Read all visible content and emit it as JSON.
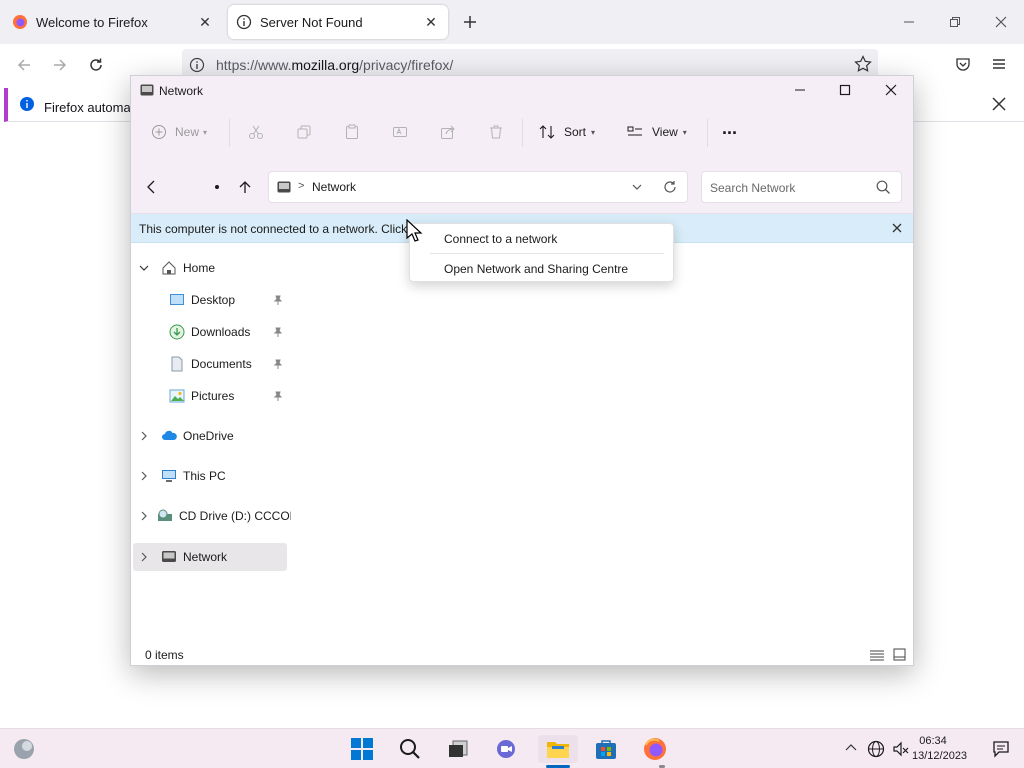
{
  "browser": {
    "tabs": [
      {
        "title": "Welcome to Firefox",
        "active": false
      },
      {
        "title": "Server Not Found",
        "active": true
      }
    ],
    "url_prefix": "https://www.",
    "url_domain": "mozilla.org",
    "url_path": "/privacy/firefox/",
    "notification": "Firefox automati"
  },
  "explorer": {
    "title": "Network",
    "toolbar": {
      "new_label": "New",
      "sort_label": "Sort",
      "view_label": "View",
      "more_label": "..."
    },
    "address": {
      "separator": ">",
      "location": "Network"
    },
    "search": {
      "placeholder": "Search Network"
    },
    "infobar": {
      "text": "This computer is not connected to a network. Click t"
    },
    "nav": {
      "home": "Home",
      "quick": [
        "Desktop",
        "Downloads",
        "Documents",
        "Pictures"
      ],
      "roots": [
        "OneDrive",
        "This PC",
        "CD Drive (D:) CCCOM",
        "Network"
      ]
    },
    "status": {
      "items": "0 items"
    }
  },
  "context_menu": {
    "items": [
      "Connect to a network",
      "Open Network and Sharing Centre"
    ]
  },
  "taskbar": {
    "time": "06:34",
    "date": "13/12/2023"
  },
  "colors": {
    "accent": "#0067c0",
    "explorer_bg": "#f5eef6",
    "infobar_bg": "#d8edf9",
    "taskbar_bg": "#f6eaf2"
  }
}
